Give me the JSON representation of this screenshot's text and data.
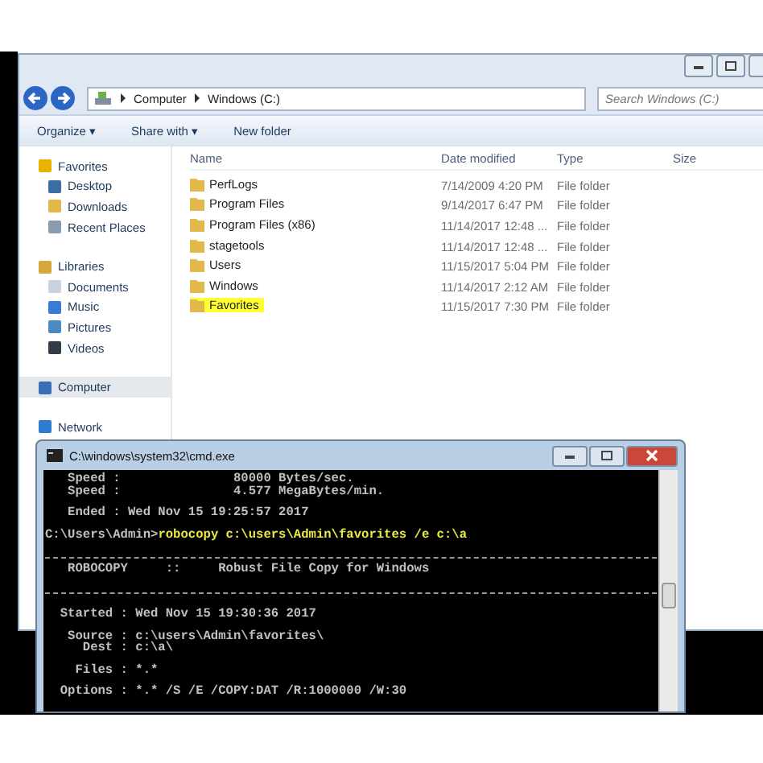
{
  "explorer": {
    "address": [
      "Computer",
      "Windows (C:)"
    ],
    "search": {
      "placeholder": "Search Windows (C:)"
    },
    "toolbar": [
      "Organize ▾",
      "Share with ▾",
      "New folder"
    ],
    "nav": [
      {
        "label": "Favorites",
        "selected": false,
        "children": [
          {
            "label": "Desktop",
            "selected": false
          },
          {
            "label": "Downloads",
            "selected": false
          },
          {
            "label": "Recent Places",
            "selected": false
          }
        ]
      },
      {
        "label": "Libraries",
        "selected": false,
        "children": [
          {
            "label": "Documents",
            "selected": false
          },
          {
            "label": "Music",
            "selected": false
          },
          {
            "label": "Pictures",
            "selected": false
          },
          {
            "label": "Videos",
            "selected": false
          }
        ]
      },
      {
        "label": "Computer",
        "selected": true
      },
      {
        "label": "Network",
        "selected": false
      }
    ],
    "columns": [
      "Name",
      "Date modified",
      "Type",
      "Size"
    ],
    "files": [
      {
        "name": "PerfLogs",
        "date": "7/14/2009 4:20 PM",
        "type": "File folder",
        "highlighted": false
      },
      {
        "name": "Program Files",
        "date": "9/14/2017 6:47 PM",
        "type": "File folder",
        "highlighted": false
      },
      {
        "name": "Program Files (x86)",
        "date": "11/14/2017 12:48 ...",
        "type": "File folder",
        "highlighted": false
      },
      {
        "name": "stagetools",
        "date": "11/14/2017 12:48 ...",
        "type": "File folder",
        "highlighted": false
      },
      {
        "name": "Users",
        "date": "11/15/2017 5:04 PM",
        "type": "File folder",
        "highlighted": false
      },
      {
        "name": "Windows",
        "date": "11/14/2017 2:12 AM",
        "type": "File folder",
        "highlighted": false
      },
      {
        "name": "Favorites",
        "date": "11/15/2017 7:30 PM",
        "type": "File folder",
        "highlighted": true
      }
    ]
  },
  "cmd": {
    "title": "C:\\windows\\system32\\cmd.exe",
    "lines": [
      {
        "kind": "output",
        "text": "   Speed :               80000 Bytes/sec."
      },
      {
        "kind": "output",
        "text": "   Speed :               4.577 MegaBytes/min."
      },
      {
        "kind": "blank"
      },
      {
        "kind": "output",
        "text": "   Ended : Wed Nov 15 19:25:57 2017"
      },
      {
        "kind": "blank"
      },
      {
        "kind": "command",
        "prompt": "C:\\Users\\Admin>",
        "text": "robocopy c:\\users\\Admin\\favorites /e c:\\a"
      },
      {
        "kind": "blank"
      },
      {
        "kind": "rule"
      },
      {
        "kind": "output",
        "text": "   ROBOCOPY     ::     Robust File Copy for Windows"
      },
      {
        "kind": "blank"
      },
      {
        "kind": "rule"
      },
      {
        "kind": "blank"
      },
      {
        "kind": "output",
        "text": "  Started : Wed Nov 15 19:30:36 2017"
      },
      {
        "kind": "blank"
      },
      {
        "kind": "output",
        "text": "   Source : c:\\users\\Admin\\favorites\\"
      },
      {
        "kind": "output",
        "text": "     Dest : c:\\a\\"
      },
      {
        "kind": "blank"
      },
      {
        "kind": "output",
        "text": "    Files : *.*"
      },
      {
        "kind": "blank"
      },
      {
        "kind": "output",
        "text": "  Options : *.* /S /E /COPY:DAT /R:1000000 /W:30"
      }
    ]
  }
}
